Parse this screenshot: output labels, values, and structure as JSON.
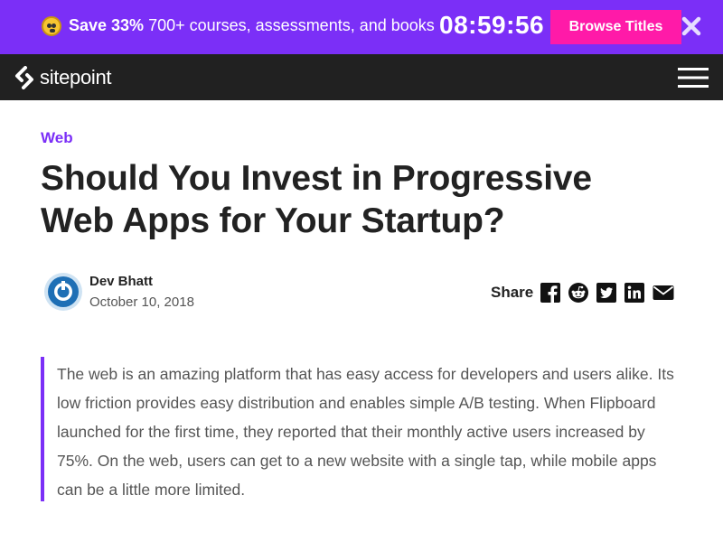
{
  "promo": {
    "offer_bold": "Save 33%",
    "offer_text": "700+ courses, assessments, and books",
    "timer": "08:59:56",
    "cta_label": "Browse Titles",
    "emoji_icon": "shocked-face-icon",
    "close_icon": "close-icon",
    "bg_color": "#7b2ff7",
    "cta_color": "#ff1aa8"
  },
  "nav": {
    "logo_text": "sitepoint",
    "menu_icon": "hamburger-menu-icon"
  },
  "article": {
    "category": "Web",
    "title": "Should You Invest in Progressive Web Apps for Your Startup?",
    "author": "Dev Bhatt",
    "date": "October 10, 2018",
    "share_label": "Share",
    "share_icons": [
      "facebook-icon",
      "reddit-icon",
      "twitter-icon",
      "linkedin-icon",
      "email-icon"
    ],
    "quote": "The web is an amazing platform that has easy access for developers and users alike. Its low friction provides easy distribution and enables simple A/B testing. When Flipboard launched for the first time, they reported that their monthly active users increased by 75%. On the web, users can get to a new website with a single tap, while mobile apps can be a little more limited.",
    "accent_color": "#7b2ff7"
  }
}
